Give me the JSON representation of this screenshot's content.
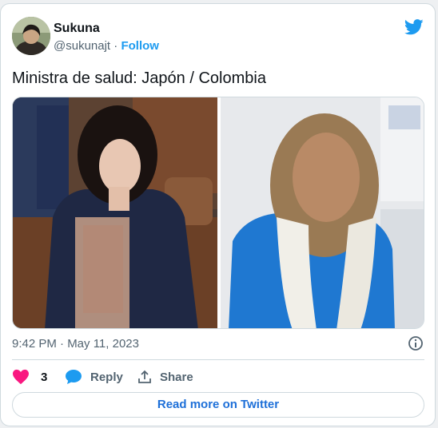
{
  "author": {
    "display_name": "Sukuna",
    "handle": "@sukunajt",
    "separator": "·",
    "follow_label": "Follow"
  },
  "tweet": {
    "text": "Ministra de salud: Japón / Colombia",
    "timestamp": "9:42 PM · May 11, 2023"
  },
  "actions": {
    "like_count": "3",
    "reply_label": "Reply",
    "share_label": "Share"
  },
  "read_more_label": "Read more on Twitter",
  "colors": {
    "brand": "#1d9bf0",
    "like": "#f91880",
    "text": "#0f1419",
    "muted": "#536471"
  },
  "icons": [
    "twitter-bird-icon",
    "info-icon",
    "heart-icon",
    "reply-bubble-icon",
    "share-icon"
  ]
}
